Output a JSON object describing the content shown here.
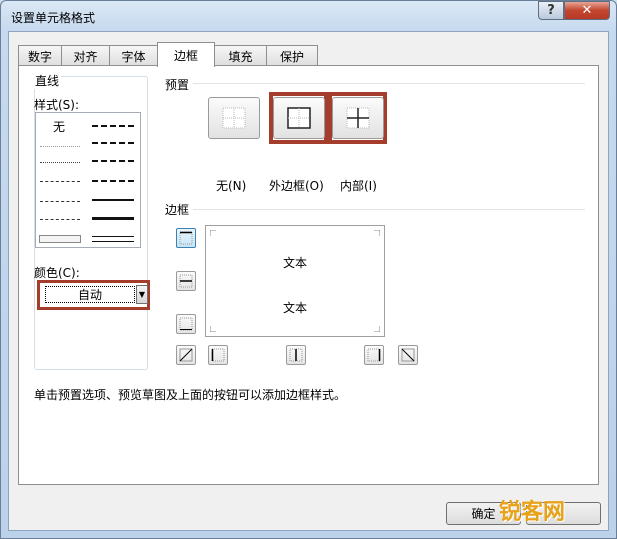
{
  "window": {
    "title": "设置单元格格式"
  },
  "titlebar": {
    "help_label": "?",
    "close_label": "✕"
  },
  "tabs": [
    {
      "label": "数字"
    },
    {
      "label": "对齐"
    },
    {
      "label": "字体"
    },
    {
      "label": "边框",
      "active": true
    },
    {
      "label": "填充"
    },
    {
      "label": "保护"
    }
  ],
  "line_group": {
    "title": "直线",
    "style_label": "样式(S):",
    "none_label": "无",
    "color_label": "颜色(C):",
    "color_value": "自动"
  },
  "presets": {
    "title": "预置",
    "items": [
      {
        "label": "无(N)"
      },
      {
        "label": "外边框(O)"
      },
      {
        "label": "内部(I)"
      }
    ]
  },
  "border_section": {
    "title": "边框",
    "preview_texts": [
      "文本",
      "文本"
    ]
  },
  "hint": "单击预置选项、预览草图及上面的按钮可以添加边框样式。",
  "buttons": {
    "ok": "确定"
  },
  "watermark": "锐客网",
  "colors": {
    "highlight": "#a43d2c",
    "watermark": "#e8a218"
  }
}
